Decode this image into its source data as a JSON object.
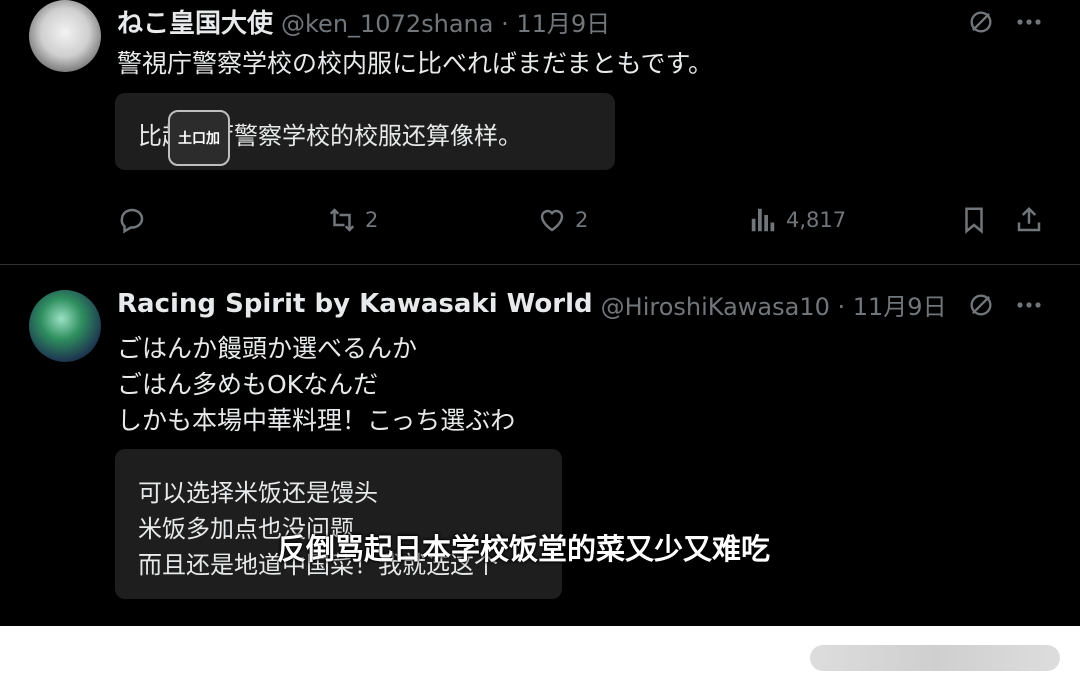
{
  "tweet1": {
    "name": "ねこ皇国大使",
    "handle_date": "@ken_1072shana · 11月9日",
    "text": "警視庁警察学校の校内服に比べればまだまともです。",
    "translation": "比起视厅警察学校的校服还算像样。",
    "actions": {
      "retweets": "2",
      "likes": "2",
      "views": "4,817"
    },
    "watermark_text": "土口加"
  },
  "tweet2": {
    "name": "Racing Spirit by Kawasaki World",
    "handle_date": "@HiroshiKawasa10 · 11月9日",
    "lines": [
      "ごはんか饅頭か選べるんか",
      "ごはん多めもOKなんだ",
      "しかも本場中華料理！こっち選ぶわ"
    ],
    "translation_lines": [
      "可以选择米饭还是馒头",
      "米饭多加点也没问题",
      "而且还是地道中国菜！我就选这个"
    ]
  },
  "subtitle": "反倒骂起日本学校饭堂的菜又少又难吃",
  "colors": {
    "background": "#000000",
    "text": "#e7e9ea",
    "muted": "#71767b",
    "card": "#1e1e1e"
  },
  "icons": [
    "grok-icon",
    "more-icon",
    "reply-icon",
    "retweet-icon",
    "like-icon",
    "views-icon",
    "bookmark-icon",
    "share-icon"
  ]
}
